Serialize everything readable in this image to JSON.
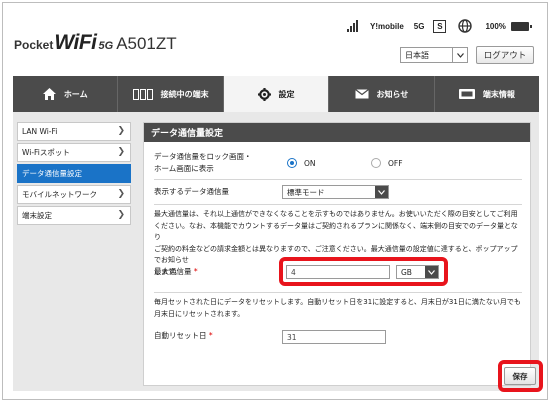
{
  "header": {
    "logo": {
      "pocket": "Pocket",
      "wifi": "WiFi",
      "fiveg": "5G",
      "model": "A501ZT"
    },
    "status": {
      "carrier": "Y!mobile",
      "network": "5G",
      "sim": "S",
      "battery": "100%"
    },
    "language": {
      "selected": "日本語"
    },
    "logout_label": "ログアウト"
  },
  "nav": {
    "tabs": [
      {
        "label": "ホーム",
        "icon": "home-icon",
        "active": false
      },
      {
        "label": "接続中の端末",
        "icon": "devices-icon",
        "active": false
      },
      {
        "label": "設定",
        "icon": "gear-icon",
        "active": true
      },
      {
        "label": "お知らせ",
        "icon": "mail-icon",
        "active": false
      },
      {
        "label": "端末情報",
        "icon": "device-info-icon",
        "active": false
      }
    ]
  },
  "sidebar": {
    "items": [
      {
        "label": "LAN Wi-Fi",
        "active": false
      },
      {
        "label": "Wi-Fiスポット",
        "active": false
      },
      {
        "label": "データ通信量設定",
        "active": true
      },
      {
        "label": "モバイルネットワーク",
        "active": false
      },
      {
        "label": "端末設定",
        "active": false
      }
    ]
  },
  "panel": {
    "title": "データ通信量設定",
    "lock_label_1": "データ通信量をロック画面・",
    "lock_label_2": "ホーム画面に表示",
    "on_label": "ON",
    "off_label": "OFF",
    "lock_value": "ON",
    "display_label": "表示するデータ通信量",
    "display_value": "標準モード",
    "notice_lines": [
      "最大通信量は、それ以上通信ができなくなることを示すものではありません。お使いいただく際の目安としてご利用",
      "ください。なお、本機能でカウントするデータ量はご契約されるプランに関係なく、端末側の目安でのデータ量となり",
      "ご契約の料金などの請求金額とは異なりますので、ご注意ください。最大通信量の設定値に達すると、ポップアップでお知らせ",
      "します。"
    ],
    "max_label": "最大通信量",
    "required_mark": "*",
    "max_value": "4",
    "unit_value": "GB",
    "reset_note_lines": [
      "毎月セットされた日にデータをリセットします。自動リセット日を31に設定すると、月末日が31日に満たない月でも",
      "月末日にリセットされます。"
    ],
    "reset_label": "自動リセット日",
    "reset_value": "31",
    "save_label": "保存"
  },
  "colors": {
    "accent": "#1a73c7",
    "nav_bg": "#4b4b4b",
    "highlight": "#e8141c"
  }
}
